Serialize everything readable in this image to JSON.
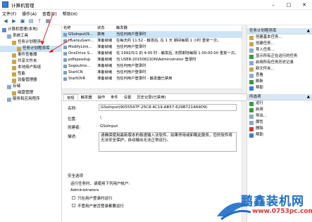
{
  "window": {
    "title": "计算机管理"
  },
  "menubar": [
    "文件(F)",
    "操作(A)",
    "查看(V)",
    "帮助(H)"
  ],
  "tree": [
    {
      "label": "计算机管理(本地)",
      "indent": 0
    },
    {
      "label": "系统工具",
      "indent": 1
    },
    {
      "label": "任务计划程序",
      "indent": 2
    },
    {
      "label": "任务计划程序库",
      "indent": 3,
      "selected": true
    },
    {
      "label": "事件查看器",
      "indent": 2
    },
    {
      "label": "共享文件夹",
      "indent": 2
    },
    {
      "label": "本地用户和组",
      "indent": 2
    },
    {
      "label": "性能",
      "indent": 2
    },
    {
      "label": "设备管理器",
      "indent": 2
    },
    {
      "label": "存储",
      "indent": 1
    },
    {
      "label": "磁盘管理",
      "indent": 2
    },
    {
      "label": "服务和应用程序",
      "indent": 1
    }
  ],
  "tasklist": {
    "headers": [
      "名称",
      "状态",
      "触发器"
    ],
    "rows": [
      {
        "name": "GSoInput(9...",
        "status": "禁用",
        "trigger": "当任何用户登录时",
        "selected": true
      },
      {
        "name": "HuanjuGam...",
        "status": "准备就绪",
        "trigger": "在每天的 11:52 - 触发后, 在 1 天 期间每隔 1 小时 重复一次。"
      },
      {
        "name": "ModifyLink...",
        "status": "准备就绪",
        "trigger": "当任何用户登录时"
      },
      {
        "name": "OneDrive S...",
        "status": "准备就绪",
        "trigger": "在 1992/5/1 的 4:00 时 - 触发后, 无限期地每隔 1.00:00:00 重复一次。"
      },
      {
        "name": "pdfspeedup",
        "status": "准备就绪",
        "trigger": "当 USER-20150821DN\\Administrator 登录时"
      },
      {
        "name": "SogouIme...",
        "status": "准备就绪",
        "trigger": "当任何用户登录时"
      },
      {
        "name": "StartCN",
        "status": "准备就绪",
        "trigger": "当任何用户登录时"
      },
      {
        "name": "StartDVR",
        "status": "准备就绪",
        "trigger": "当任何用户登录时 - 触发器已禁用"
      }
    ]
  },
  "details": {
    "tabs": [
      "常规",
      "触发器",
      "操作",
      "条件",
      "设置",
      "历史记录(已禁用)"
    ],
    "name_label": "名称:",
    "name_value": "GSoInput(9055547F-25C8-4C19-AB57-629B7214A9D9)",
    "location_label": "位置:",
    "location_value": "\\",
    "author_label": "创建者:",
    "author_value": "GSoInput",
    "desc_label": "描述:",
    "desc_value": "请确保使用最新版本的极速输入法软件。如果停用或卸载此服务，您的软件将无法安全保护，自动输出无法正常运行。",
    "security_label": "安全选项",
    "run_as_label": "运行任务时，请使用下列用户帐户:",
    "run_as_value": "Administrators",
    "option1": "只在用户登录时运行",
    "option2": "不管用户是否登录都要运行"
  },
  "actions": {
    "section1_title": "任务计划程序库",
    "section1_items": [
      "创建基本任务...",
      "创建任务...",
      "导入任务...",
      "显示所有正在运行的任务",
      "启用所有任务历史记录",
      "新文件夹...",
      "查看",
      "刷新",
      "帮助"
    ],
    "section2_title": "所选项",
    "section2_items": [
      "运行",
      "启用",
      "导出...",
      "属性",
      "删除",
      "帮助"
    ]
  },
  "watermark": {
    "brand": "鹏鑫装机网",
    "url": "www.0753pc.com"
  }
}
